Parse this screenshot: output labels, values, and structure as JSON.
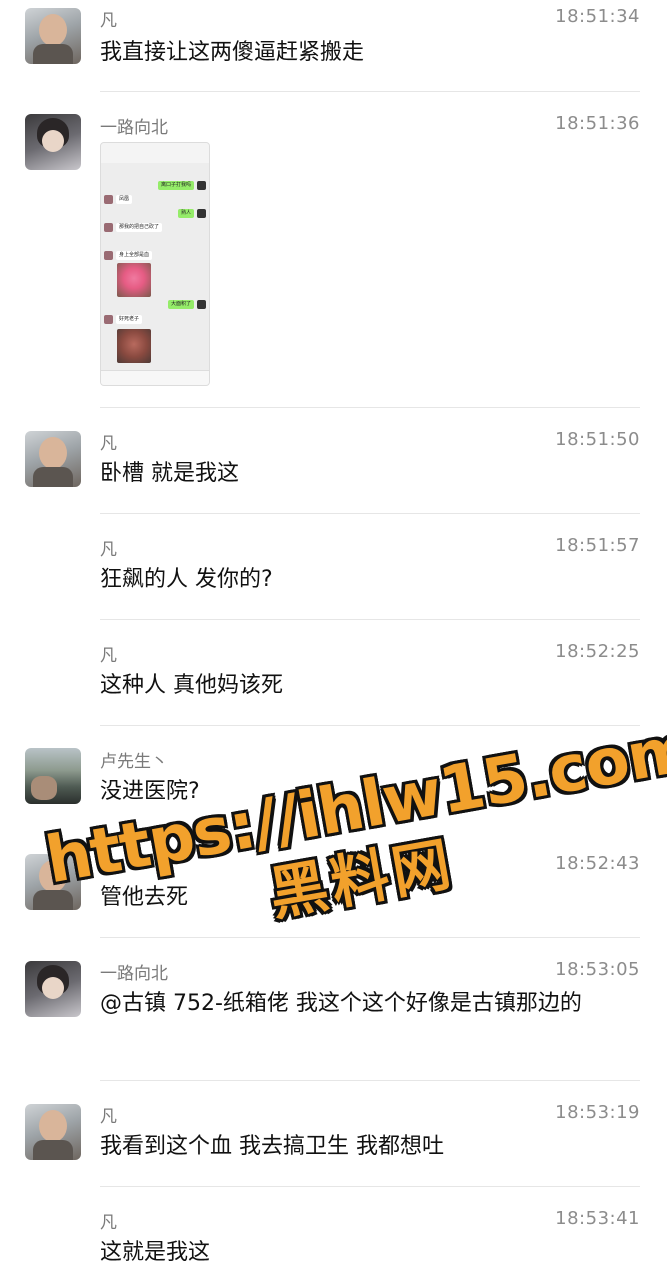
{
  "messages": [
    {
      "name": "凡",
      "time": "18:51:34",
      "text": "我直接让这两傻逼赶紧搬走"
    },
    {
      "name": "一路向北",
      "time": "18:51:36",
      "text": ""
    },
    {
      "name": "凡",
      "time": "18:51:50",
      "text": "卧槽 就是我这"
    },
    {
      "name": "凡",
      "time": "18:51:57",
      "text": "狂飙的人 发你的?"
    },
    {
      "name": "凡",
      "time": "18:52:25",
      "text": "这种人 真他妈该死"
    },
    {
      "name": "卢先生丶",
      "time": "",
      "text": "没进医院?"
    },
    {
      "name": "",
      "time": "18:52:43",
      "text": "管他去死"
    },
    {
      "name": "一路向北",
      "time": "18:53:05",
      "text": "@古镇 752-纸箱佬 我这个这个好像是古镇那边的"
    },
    {
      "name": "凡",
      "time": "18:53:19",
      "text": "我看到这个血  我去搞卫生 我都想吐"
    },
    {
      "name": "凡",
      "time": "18:53:41",
      "text": "这就是我这"
    }
  ],
  "screenshot_bubbles": [
    "离口子打我吗",
    "凤凰",
    "熟人",
    "那我的把自己砍了",
    "身上全部是血",
    "大面积了",
    "好死老子"
  ],
  "watermark": {
    "url": "https://ihlw15.com",
    "label": "黑料网",
    "color": "#f2a12c"
  },
  "colors": {
    "name": "#7a7a7a",
    "time": "#8c8c8c",
    "bubble_green": "#95ec69"
  }
}
